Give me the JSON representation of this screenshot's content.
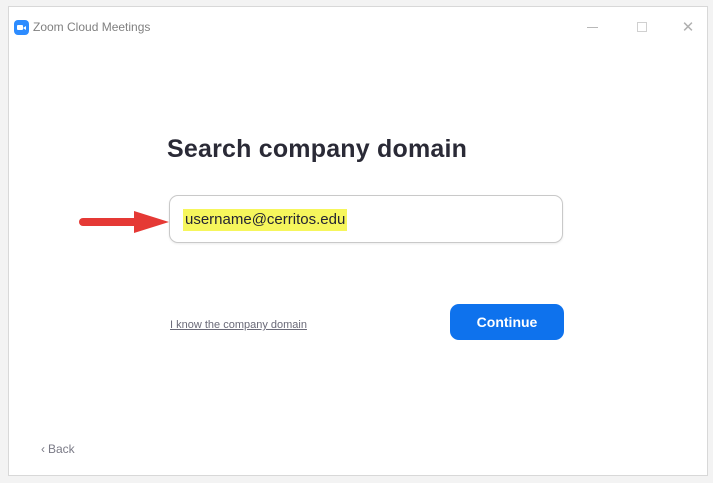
{
  "window": {
    "title": "Zoom Cloud Meetings",
    "app_icon": "zoom-camera-icon",
    "controls": {
      "minimize": "minimize-icon",
      "maximize": "maximize-icon",
      "close_label": "✕"
    }
  },
  "main": {
    "heading": "Search company domain",
    "domain_input": {
      "value": "username@cerritos.edu",
      "highlight_color": "#f6f65c"
    },
    "annotation_arrow": {
      "icon": "red-arrow-right-icon",
      "color": "#e53935"
    },
    "know_domain_link": "I know the company domain",
    "continue_button": "Continue",
    "accent_color": "#0e72ed"
  },
  "footer": {
    "back_icon": "chevron-left-icon",
    "back_label": "Back"
  }
}
